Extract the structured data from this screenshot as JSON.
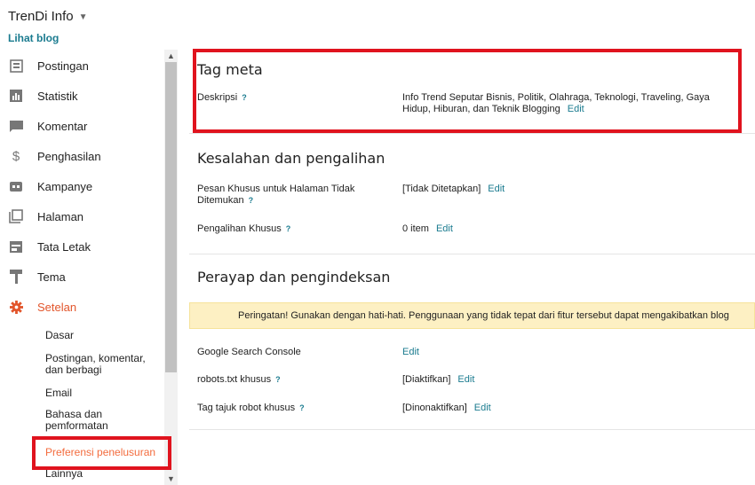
{
  "header": {
    "blog_title": "TrenDi Info",
    "view_blog": "Lihat blog"
  },
  "sidebar": {
    "items": [
      {
        "label": "Postingan",
        "icon": "posts-icon"
      },
      {
        "label": "Statistik",
        "icon": "stats-icon"
      },
      {
        "label": "Komentar",
        "icon": "comment-icon"
      },
      {
        "label": "Penghasilan",
        "icon": "dollar-icon"
      },
      {
        "label": "Kampanye",
        "icon": "ad-icon"
      },
      {
        "label": "Halaman",
        "icon": "pages-icon"
      },
      {
        "label": "Tata Letak",
        "icon": "layout-icon"
      },
      {
        "label": "Tema",
        "icon": "paint-roller-icon"
      },
      {
        "label": "Setelan",
        "icon": "gear-icon"
      }
    ],
    "sub_items": [
      {
        "label": "Dasar"
      },
      {
        "label": "Postingan, komentar, dan berbagi"
      },
      {
        "label": "Email"
      },
      {
        "label": "Bahasa dan pemformatan"
      },
      {
        "label": "Preferensi penelusuran"
      },
      {
        "label": "Lainnya"
      }
    ],
    "active_color": "#e2552b"
  },
  "main": {
    "sections": [
      {
        "title": "Tag meta",
        "rows": [
          {
            "label": "Deskripsi",
            "value": "Info Trend Seputar Bisnis, Politik, Olahraga, Teknologi, Traveling, Gaya Hidup, Hiburan, dan Teknik Blogging",
            "edit": "Edit"
          }
        ]
      },
      {
        "title": "Kesalahan dan pengalihan",
        "rows": [
          {
            "label": "Pesan Khusus untuk Halaman Tidak Ditemukan",
            "value": "[Tidak Ditetapkan]",
            "edit": "Edit"
          },
          {
            "label": "Pengalihan Khusus",
            "value": "0 item",
            "edit": "Edit"
          }
        ]
      },
      {
        "title": "Perayap dan pengindeksan",
        "warning": "Peringatan! Gunakan dengan hati-hati. Penggunaan yang tidak tepat dari fitur tersebut dapat mengakibatkan blog",
        "rows": [
          {
            "label": "Google Search Console",
            "value": "",
            "edit": "Edit"
          },
          {
            "label": "robots.txt khusus",
            "value": "[Diaktifkan]",
            "edit": "Edit"
          },
          {
            "label": "Tag tajuk robot khusus",
            "value": "[Dinonaktifkan]",
            "edit": "Edit"
          }
        ]
      }
    ],
    "help_glyph": "?"
  },
  "colors": {
    "link": "#1a7b8f",
    "highlight_border": "#e0131e",
    "warning_bg": "#fdf0c3"
  }
}
